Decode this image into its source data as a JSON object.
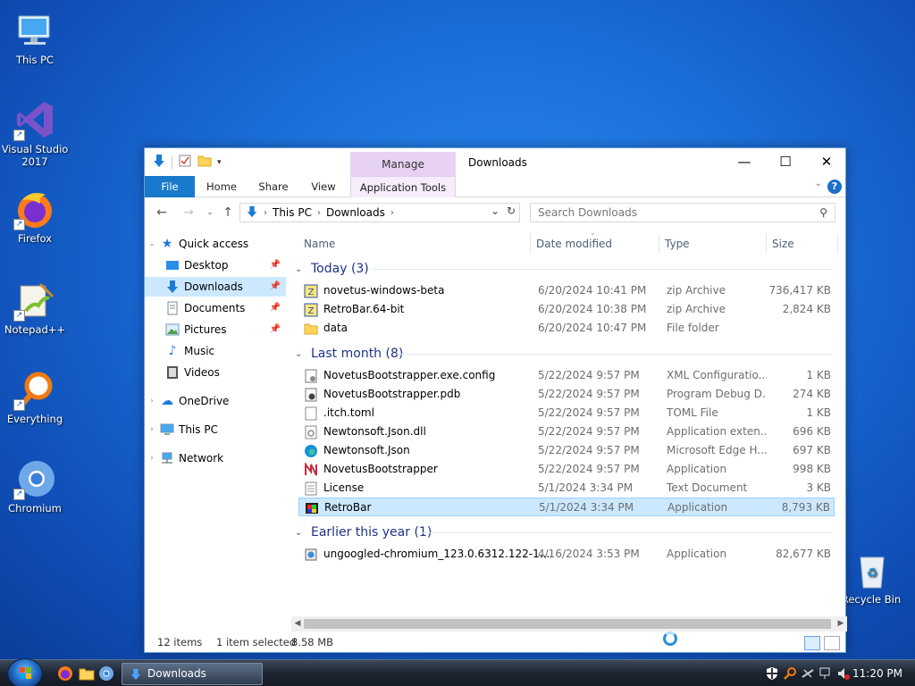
{
  "desktop": {
    "icons": [
      {
        "label": "This PC"
      },
      {
        "label": "Visual Studio 2017"
      },
      {
        "label": "Firefox"
      },
      {
        "label": "Notepad++"
      },
      {
        "label": "Everything"
      },
      {
        "label": "Chromium"
      },
      {
        "label": "Recycle Bin"
      }
    ]
  },
  "window": {
    "title": "Downloads",
    "manage_tab": "Manage",
    "ribbon_tabs": [
      "File",
      "Home",
      "Share",
      "View",
      "Application Tools"
    ],
    "help": "?",
    "address": {
      "segments": [
        "This PC",
        "Downloads"
      ]
    },
    "search_placeholder": "Search Downloads",
    "nav": {
      "quick_access": "Quick access",
      "pinned": [
        "Desktop",
        "Downloads",
        "Documents",
        "Pictures"
      ],
      "unpinned": [
        "Music",
        "Videos"
      ],
      "onedrive": "OneDrive",
      "this_pc": "This PC",
      "network": "Network"
    },
    "columns": [
      "Name",
      "Date modified",
      "Type",
      "Size"
    ],
    "groups": [
      {
        "label": "Today (3)",
        "files": [
          {
            "name": "novetus-windows-beta",
            "date": "6/20/2024 10:41 PM",
            "type": "zip Archive",
            "size": "736,417 KB",
            "icon": "zip-icon"
          },
          {
            "name": "RetroBar.64-bit",
            "date": "6/20/2024 10:38 PM",
            "type": "zip Archive",
            "size": "2,824 KB",
            "icon": "zip-icon"
          },
          {
            "name": "data",
            "date": "6/20/2024 10:47 PM",
            "type": "File folder",
            "size": "",
            "icon": "folder-icon"
          }
        ]
      },
      {
        "label": "Last month (8)",
        "files": [
          {
            "name": "NovetusBootstrapper.exe.config",
            "date": "5/22/2024 9:57 PM",
            "type": "XML Configuratio...",
            "size": "1 KB",
            "icon": "config-file-icon"
          },
          {
            "name": "NovetusBootstrapper.pdb",
            "date": "5/22/2024 9:57 PM",
            "type": "Program Debug D...",
            "size": "274 KB",
            "icon": "pdb-file-icon"
          },
          {
            "name": ".itch.toml",
            "date": "5/22/2024 9:57 PM",
            "type": "TOML File",
            "size": "1 KB",
            "icon": "blank-file-icon"
          },
          {
            "name": "Newtonsoft.Json.dll",
            "date": "5/22/2024 9:57 PM",
            "type": "Application exten...",
            "size": "696 KB",
            "icon": "dll-file-icon"
          },
          {
            "name": "Newtonsoft.Json",
            "date": "5/22/2024 9:57 PM",
            "type": "Microsoft Edge H...",
            "size": "697 KB",
            "icon": "edge-icon"
          },
          {
            "name": "NovetusBootstrapper",
            "date": "5/22/2024 9:57 PM",
            "type": "Application",
            "size": "998 KB",
            "icon": "novetus-icon"
          },
          {
            "name": "License",
            "date": "5/1/2024 3:34 PM",
            "type": "Text Document",
            "size": "3 KB",
            "icon": "text-file-icon"
          },
          {
            "name": "RetroBar",
            "date": "5/1/2024 3:34 PM",
            "type": "Application",
            "size": "8,793 KB",
            "icon": "retrobar-icon",
            "selected": true
          }
        ]
      },
      {
        "label": "Earlier this year (1)",
        "files": [
          {
            "name": "ungoogled-chromium_123.0.6312.122-1....",
            "date": "4/16/2024 3:53 PM",
            "type": "Application",
            "size": "82,677 KB",
            "icon": "installer-icon"
          }
        ]
      }
    ],
    "status": {
      "items": "12 items",
      "selected": "1 item selected",
      "size": "8.58 MB"
    }
  },
  "taskbar": {
    "task_label": "Downloads",
    "clock": "11:20 PM"
  },
  "colors": {
    "file_tab": "#1979ca",
    "manage_tab": "#e8d2f4",
    "selection": "#cce8ff",
    "group_header": "#1e3287"
  }
}
